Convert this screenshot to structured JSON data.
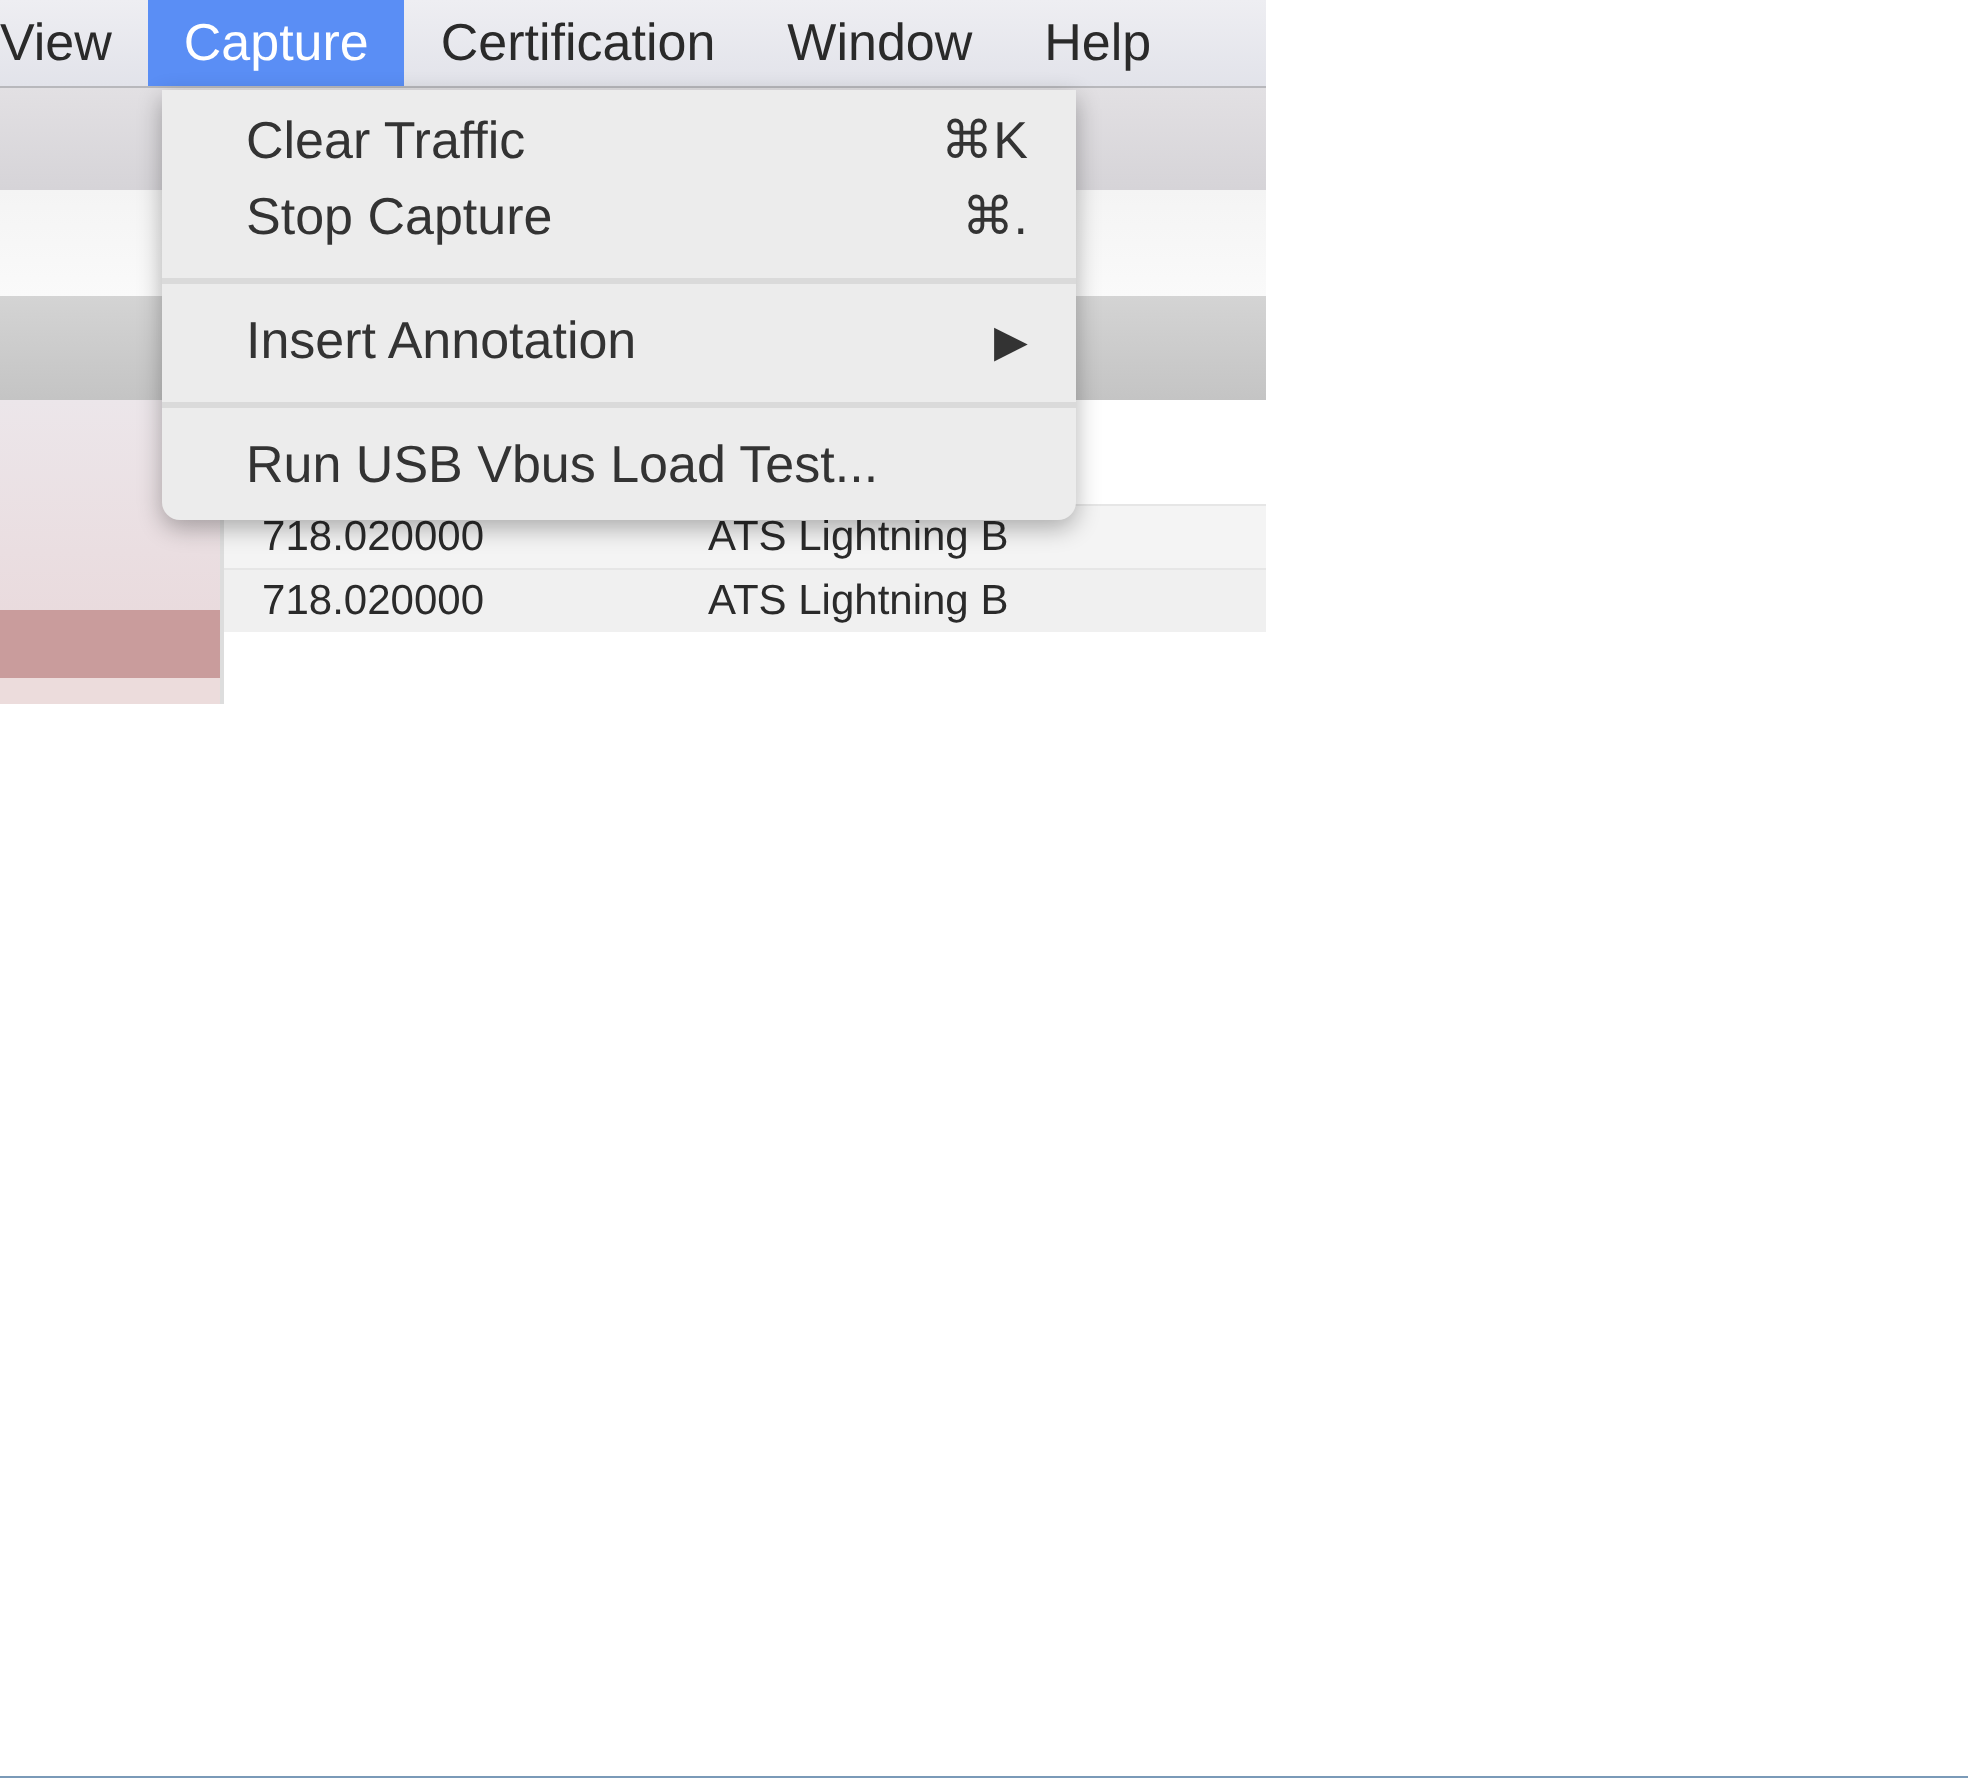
{
  "menu_bar": [
    {
      "label": "View",
      "selected": false
    },
    {
      "label": "Capture",
      "selected": true
    },
    {
      "label": "Certification",
      "selected": false
    },
    {
      "label": "Window",
      "selected": false
    },
    {
      "label": "Help",
      "selected": false
    }
  ],
  "menu": [
    {
      "kind": "item",
      "label": "Clear Traffic",
      "shortcut": "⌘K"
    },
    {
      "kind": "item",
      "label": "Stop Capture",
      "shortcut": "⌘."
    },
    {
      "kind": "separator"
    },
    {
      "kind": "submenu",
      "label": "Insert Annotation",
      "arrow": "▶"
    },
    {
      "kind": "separator"
    },
    {
      "kind": "item",
      "label": "Run USB Vbus Load Test..."
    }
  ],
  "table": {
    "rows": [
      {
        "cells": [
          "718.020000",
          "ATS Lightning B"
        ]
      },
      {
        "cells": [
          "718.020000",
          "ATS Lightning B"
        ]
      }
    ]
  }
}
